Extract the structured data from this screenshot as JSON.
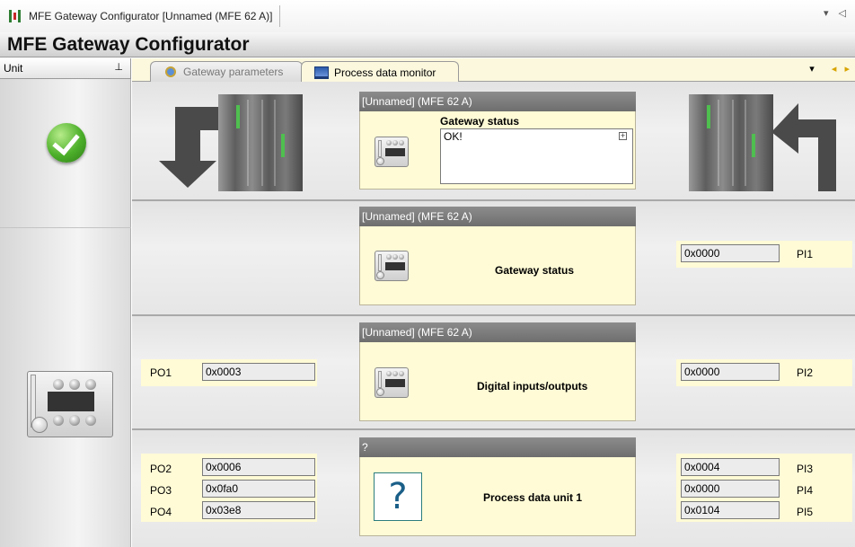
{
  "window": {
    "doc_tab_title": "MFE Gateway Configurator [Unnamed (MFE 62 A)]",
    "app_title": "MFE Gateway Configurator",
    "controls": "▾ ◁"
  },
  "unit_panel": {
    "label": "Unit",
    "pin": "⊥"
  },
  "tabs": [
    {
      "label": "Gateway parameters",
      "active": false,
      "icon": "gear-icon"
    },
    {
      "label": "Process data monitor",
      "active": true,
      "icon": "monitor-icon"
    }
  ],
  "tab_controls": {
    "dropdown": "▾",
    "prev": "◂",
    "next": "▸"
  },
  "rows": [
    {
      "panel_header": "[Unnamed] (MFE 62 A)",
      "title": "Gateway status",
      "status_text": "OK!",
      "expand": "+"
    },
    {
      "panel_header": "[Unnamed] (MFE 62 A)",
      "title": "Gateway status",
      "pi": [
        {
          "label": "PI1",
          "value": "0x0000"
        }
      ]
    },
    {
      "panel_header": "[Unnamed] (MFE 62 A)",
      "title": "Digital inputs/outputs",
      "po": [
        {
          "label": "PO1",
          "value": "0x0003"
        }
      ],
      "pi": [
        {
          "label": "PI2",
          "value": "0x0000"
        }
      ]
    },
    {
      "panel_header": "?",
      "title": "Process data unit 1",
      "icon_text": "?",
      "po": [
        {
          "label": "PO2",
          "value": "0x0006"
        },
        {
          "label": "PO3",
          "value": "0x0fa0"
        },
        {
          "label": "PO4",
          "value": "0x03e8"
        }
      ],
      "pi": [
        {
          "label": "PI3",
          "value": "0x0004"
        },
        {
          "label": "PI4",
          "value": "0x0000"
        },
        {
          "label": "PI5",
          "value": "0x0104"
        }
      ]
    }
  ],
  "colors": {
    "panel_bg": "#fffbd6",
    "header_gray": "#7d7d7d",
    "ok_green": "#4caf2a"
  }
}
